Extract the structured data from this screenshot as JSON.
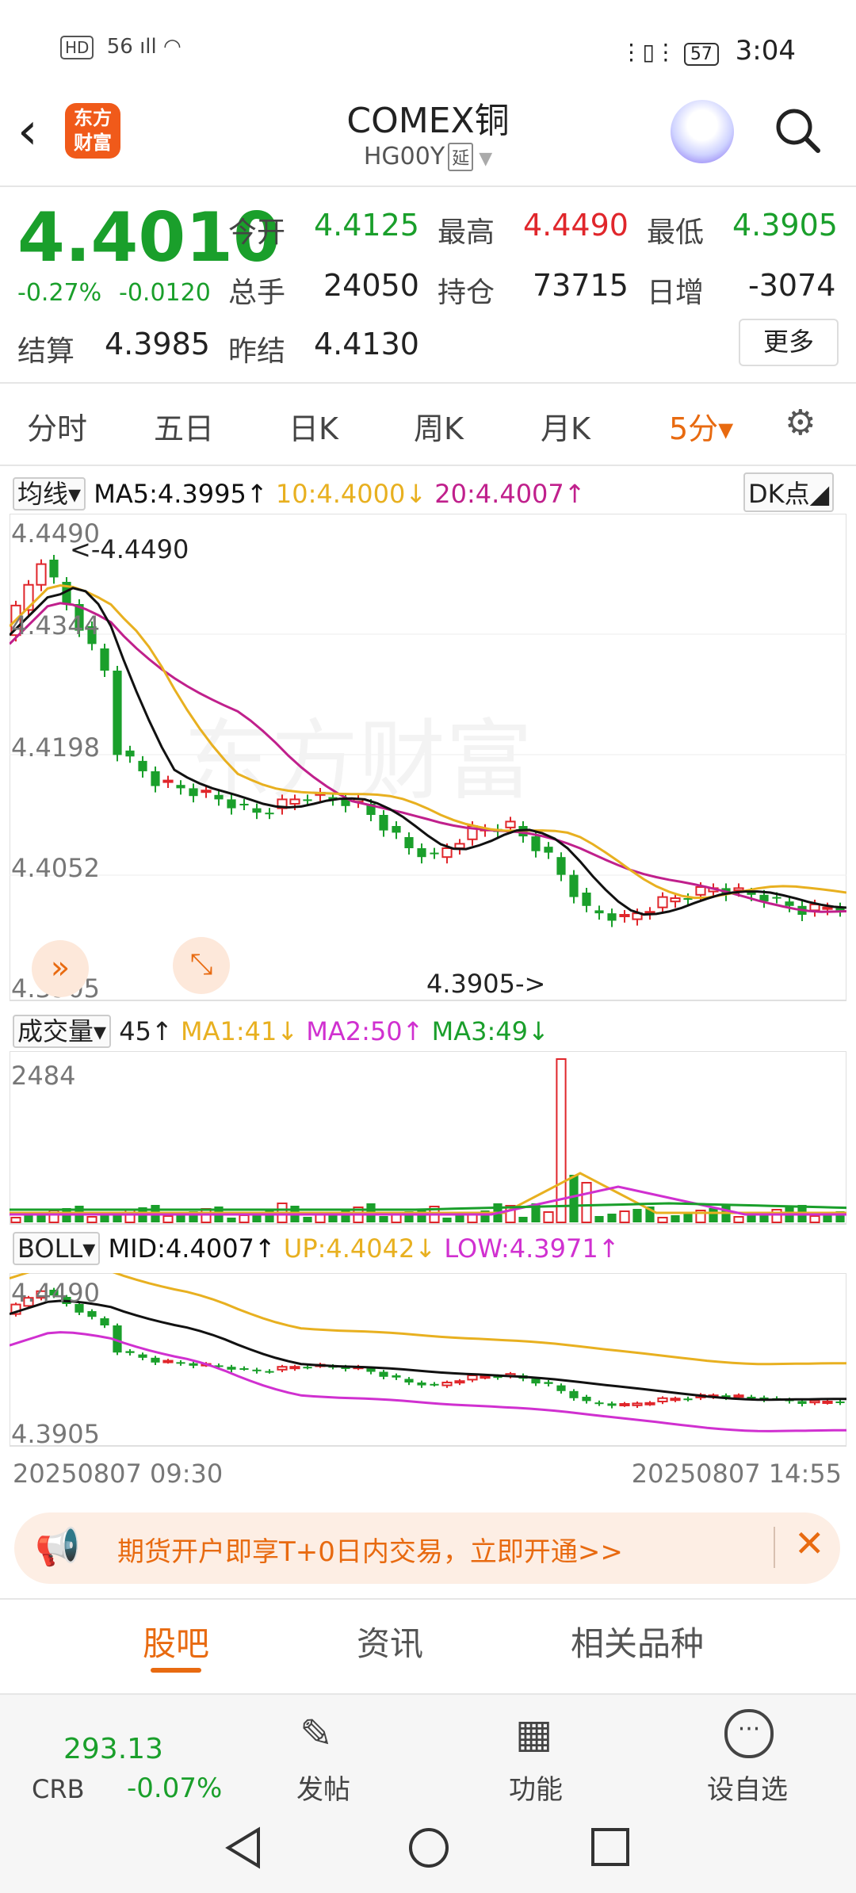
{
  "status_bar": {
    "left": "56 ıll",
    "time": "3:04",
    "battery": "57",
    "hd": "HD"
  },
  "header": {
    "back_icon": "chevron-left-icon",
    "logo_line1": "东方",
    "logo_line2": "财富",
    "title": "COMEX铜",
    "code": "HG00Y",
    "delay_badge": "延",
    "robot_icon": "robot-avatar-icon",
    "search_icon": "search-icon"
  },
  "quote": {
    "price": "4.4010",
    "change_pct": "-0.27%",
    "change": "-0.0120",
    "open_label": "今开",
    "open": "4.4125",
    "high_label": "最高",
    "high": "4.4490",
    "low_label": "最低",
    "low": "4.3905",
    "volume_label": "总手",
    "volume": "24050",
    "oi_label": "持仓",
    "oi": "73715",
    "daily_inc_label": "日增",
    "daily_inc": "-3074",
    "settle_label": "结算",
    "settle": "4.3985",
    "prev_settle_label": "昨结",
    "prev_settle": "4.4130",
    "more_button": "更多"
  },
  "period_tabs": [
    {
      "label": "分时"
    },
    {
      "label": "五日"
    },
    {
      "label": "日K"
    },
    {
      "label": "周K"
    },
    {
      "label": "月K"
    },
    {
      "label": "5分▾",
      "active": true
    }
  ],
  "ma_legend": {
    "selector": "均线▾",
    "ma5": "MA5:4.3995↑",
    "ma10": "10:4.4000↓",
    "ma20": "20:4.4007↑",
    "dk_button": "DK点◢"
  },
  "main_chart_labels": {
    "y1": "4.4490",
    "y2": "4.4344",
    "y3": "4.4198",
    "y4": "4.4052",
    "y5": "4.3905",
    "high_marker": "<-4.4490",
    "low_marker": "4.3905->"
  },
  "volume_legend": {
    "selector": "成交量▾",
    "value": "45↑",
    "ma1": "MA1:41↓",
    "ma2": "MA2:50↑",
    "ma3": "MA3:49↓",
    "ymax": "2484"
  },
  "boll_legend": {
    "selector": "BOLL▾",
    "mid": "MID:4.4007↑",
    "up": "UP:4.4042↓",
    "low": "LOW:4.3971↑",
    "ytop": "4.4490",
    "ybottom": "4.3905"
  },
  "time_axis": {
    "start": "20250807 09:30",
    "end": "20250807 14:55"
  },
  "banner": {
    "text": "期货开户即享T+0日内交易，立即开通>>"
  },
  "bottom_tabs": [
    {
      "label": "股吧",
      "active": true
    },
    {
      "label": "资讯"
    },
    {
      "label": "相关品种"
    }
  ],
  "toolbar": {
    "crb_value": "293.13",
    "crb_label": "CRB",
    "crb_change": "-0.07%",
    "post": "发帖",
    "func": "功能",
    "watch": "设自选"
  },
  "colors": {
    "up": "#e0262b",
    "down": "#1a9f2b",
    "accent": "#e86a10",
    "ma5": "#111111",
    "ma10": "#e8b020",
    "ma20": "#c0208c"
  }
}
